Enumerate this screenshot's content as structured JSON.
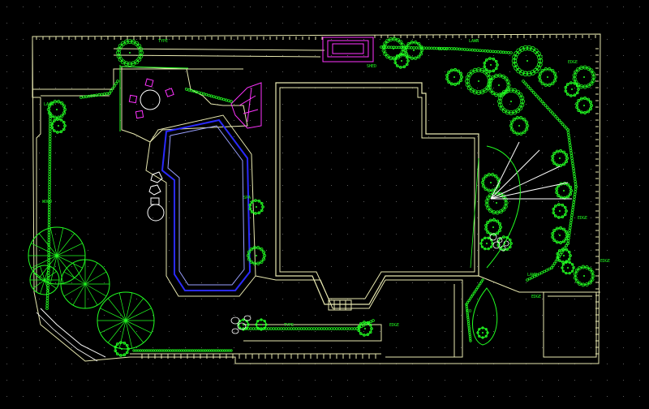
{
  "app": {
    "view": "cad-model-space",
    "background": "#000000"
  },
  "colors": {
    "background": "#000000",
    "grid_dot": "#5a5a5a",
    "outline": "#e8e8b0",
    "plants": "#22ff22",
    "plants_dark": "#16a016",
    "pool": "#2a2aff",
    "pool_inner": "#9aa0ff",
    "magenta": "#ff33ff",
    "white": "#ffffff"
  },
  "labels": {
    "top_fence": "TYPE",
    "left_hedge": "WOOD",
    "right_hedge": "EDGE",
    "sidewalk_note": "LAWN",
    "gate": "EDGE",
    "lower_fence": "TYPE",
    "shed": "SHED",
    "top_right": "LAWN",
    "right_mid": "EDGE",
    "right_low": "EDGE",
    "bed_1": "LAWN",
    "bed_2": "EDGE",
    "bed_3": "EDGE",
    "court": "CO",
    "spa": "SPA"
  }
}
